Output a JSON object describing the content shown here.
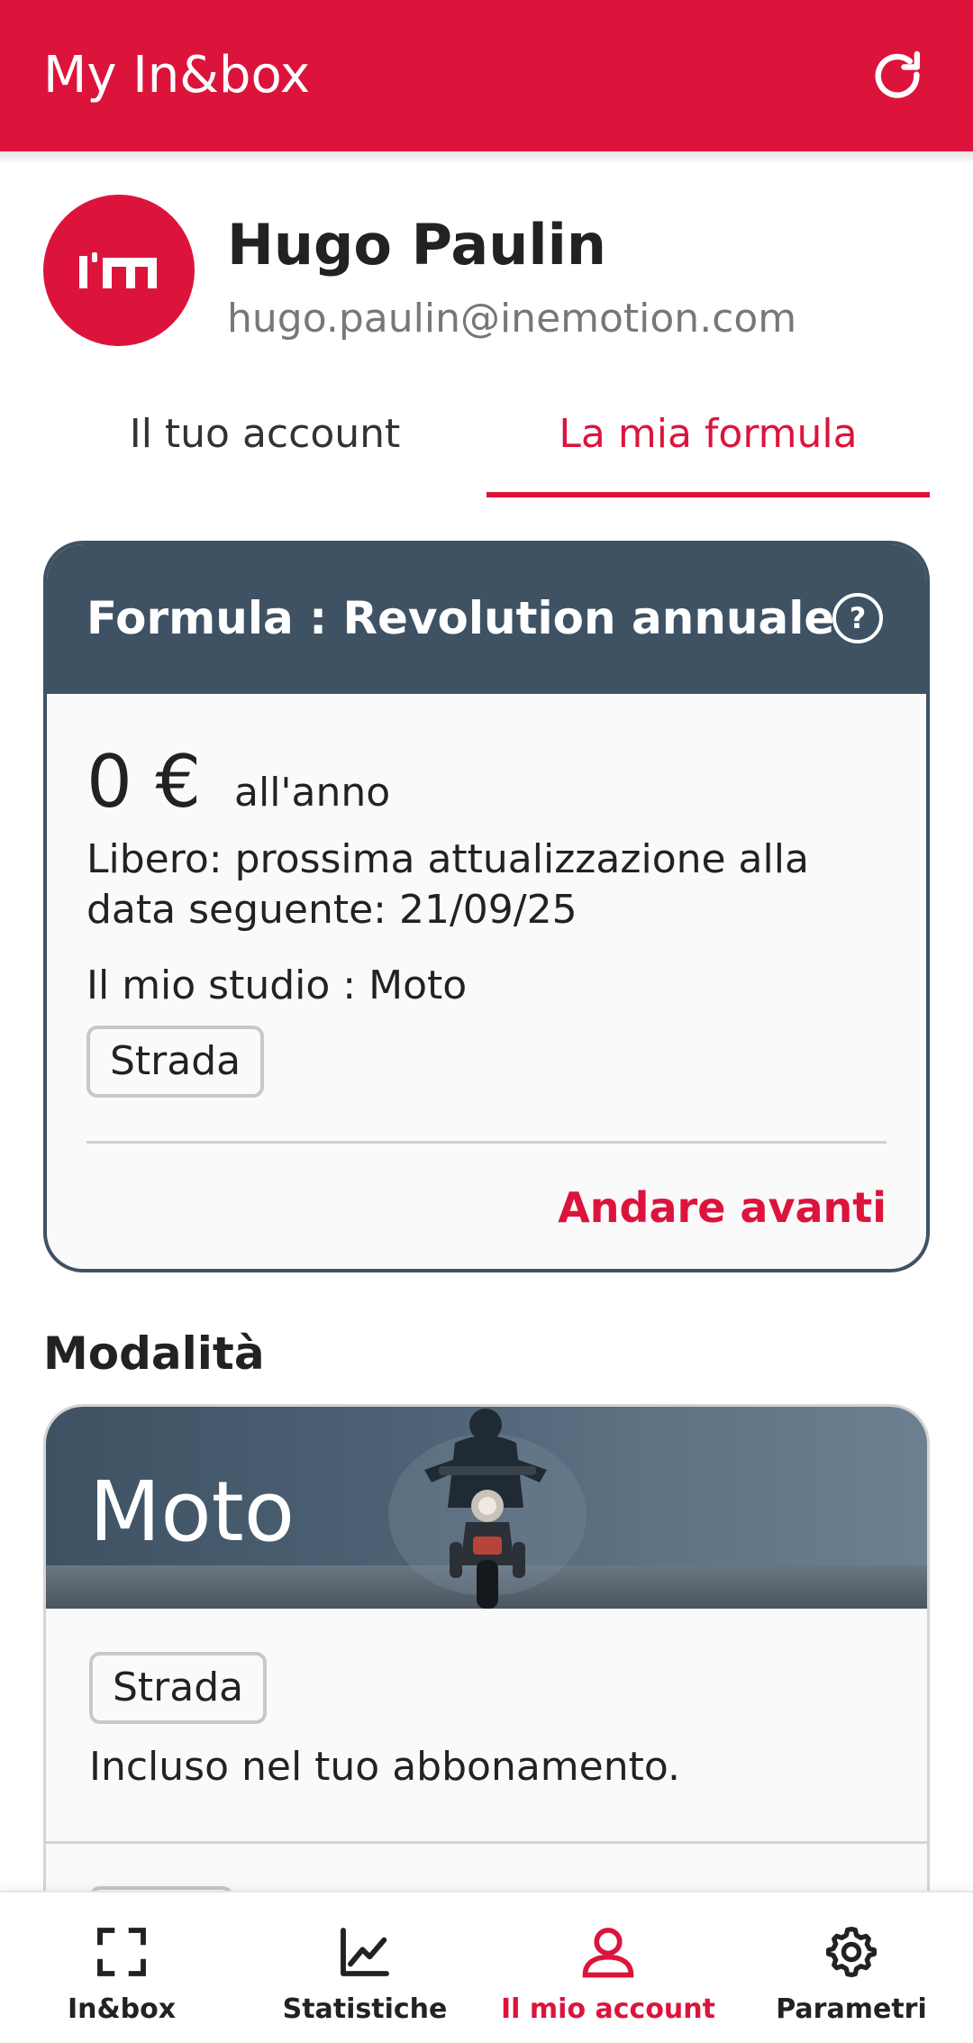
{
  "app_bar": {
    "title": "My In&box",
    "refresh_icon": "refresh-icon",
    "color": "#dc143c"
  },
  "profile": {
    "avatar_icon": "brand-logo-icon",
    "name": "Hugo Paulin",
    "email": "hugo.paulin@inemotion.com"
  },
  "tabs": [
    {
      "label": "Il tuo account",
      "selected": false
    },
    {
      "label": "La mia formula",
      "selected": true
    }
  ],
  "formula_card": {
    "title": "Formula : Revolution annuale",
    "help_icon": "help-circle-icon",
    "help_label": "?",
    "price": "0 €",
    "period": "all'anno",
    "renewal": "Libero: prossima attualizzazione alla data seguente: 21/09/25",
    "studio": "Il mio studio : Moto",
    "chip": "Strada",
    "link": "Andare avanti",
    "header_color": "#3e5264"
  },
  "section": {
    "title": "Modalità"
  },
  "mode_card": {
    "title": "Moto",
    "chip": "Strada",
    "description": "Incluso nel tuo abbonamento."
  },
  "bottom_nav": {
    "items": [
      {
        "label": "In&box",
        "icon": "scan-frame-icon",
        "active": false
      },
      {
        "label": "Statistiche",
        "icon": "chart-line-icon",
        "active": false
      },
      {
        "label": "Il mio account",
        "icon": "user-icon",
        "active": true
      },
      {
        "label": "Parametri",
        "icon": "gear-icon",
        "active": false
      }
    ],
    "active_color": "#dc143c"
  }
}
